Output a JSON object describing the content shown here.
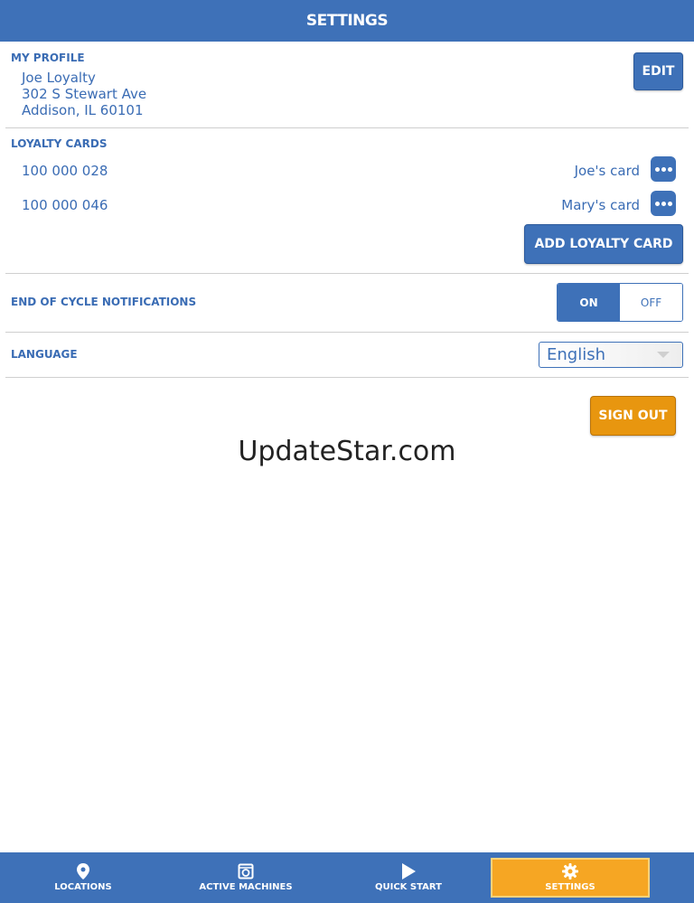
{
  "header": {
    "title": "SETTINGS"
  },
  "profile": {
    "section_title": "MY PROFILE",
    "name": "Joe Loyalty",
    "address_line1": "302 S Stewart Ave",
    "address_line2": "Addison, IL 60101",
    "edit_label": "EDIT"
  },
  "loyalty": {
    "section_title": "LOYALTY CARDS",
    "cards": [
      {
        "number": "100 000 028",
        "label": "Joe's card"
      },
      {
        "number": "100 000 046",
        "label": "Mary's card"
      }
    ],
    "add_label": "ADD LOYALTY CARD"
  },
  "notifications": {
    "label": "END OF CYCLE NOTIFICATIONS",
    "on_label": "ON",
    "off_label": "OFF",
    "state": "on"
  },
  "language": {
    "label": "LANGUAGE",
    "selected": "English"
  },
  "sign_out_label": "SIGN OUT",
  "watermark": "UpdateStar.com",
  "tabs": [
    {
      "label": "LOCATIONS",
      "icon": "map-pin-icon"
    },
    {
      "label": "ACTIVE MACHINES",
      "icon": "washer-icon"
    },
    {
      "label": "QUICK START",
      "icon": "play-icon"
    },
    {
      "label": "SETTINGS",
      "icon": "gear-icon",
      "active": true
    }
  ],
  "colors": {
    "primary": "#3e71b8",
    "accent": "#f6a623",
    "sign_out": "#e8960f"
  }
}
